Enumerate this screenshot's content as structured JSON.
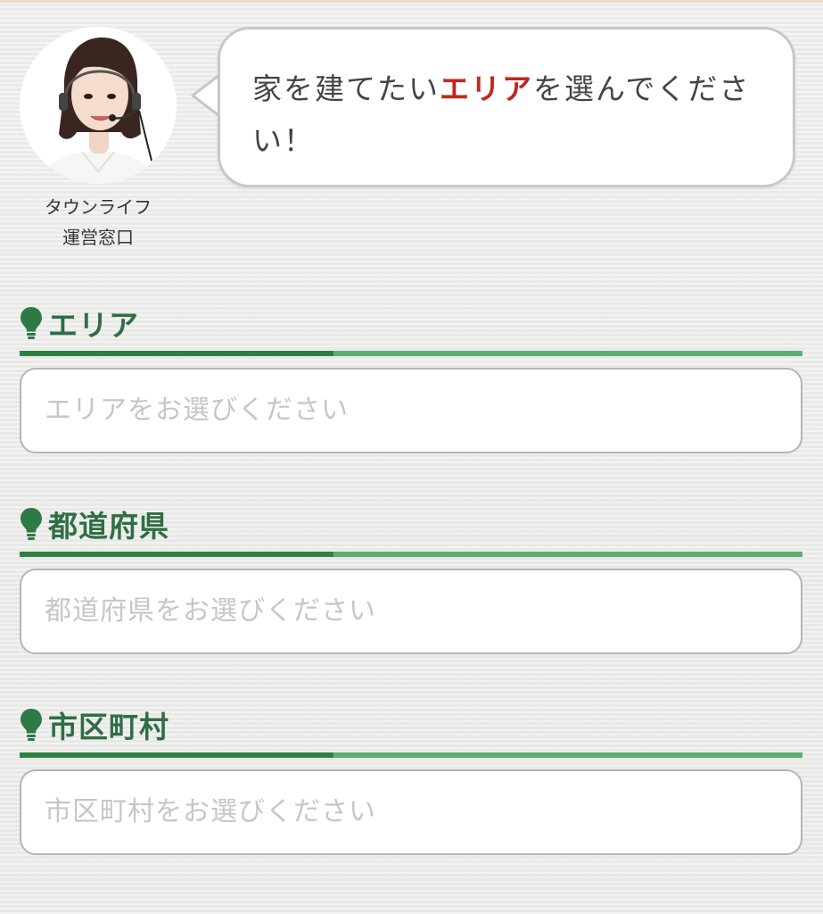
{
  "operator": {
    "name_line1": "タウンライフ",
    "name_line2": "運営窓口"
  },
  "bubble": {
    "text_before": "家を建てたい",
    "text_highlight": "エリア",
    "text_after": "を選んでください！",
    "highlight_color": "#c0281e"
  },
  "colors": {
    "heading_green": "#2f6e45",
    "underline_dark": "#2e8044",
    "underline_light": "#5fae71"
  },
  "sections": [
    {
      "title": "エリア",
      "icon": "lightbulb-icon",
      "placeholder": "エリアをお選びください"
    },
    {
      "title": "都道府県",
      "icon": "lightbulb-icon",
      "placeholder": "都道府県をお選びください"
    },
    {
      "title": "市区町村",
      "icon": "lightbulb-icon",
      "placeholder": "市区町村をお選びください"
    }
  ]
}
